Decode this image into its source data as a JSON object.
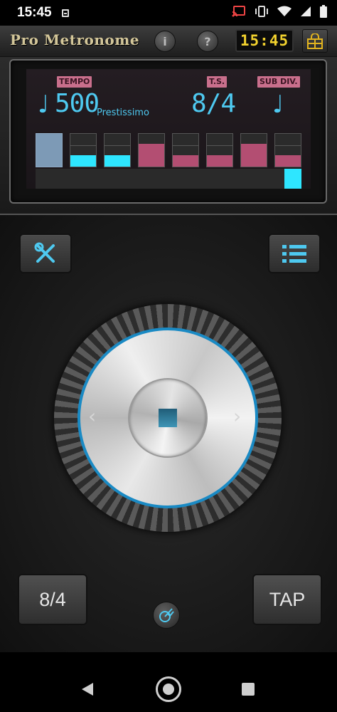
{
  "status_bar": {
    "time": "15:45"
  },
  "header": {
    "app_title": "Pro Metronome",
    "info_label": "i",
    "help_label": "?",
    "clock": "15:45"
  },
  "display": {
    "tempo_tag": "TEMPO",
    "ts_tag": "T.S.",
    "subdiv_tag": "SUB DIV.",
    "tempo_value": "500",
    "tempo_name": "Prestissimo",
    "time_signature": "8/4",
    "note_glyph": "♩",
    "subdiv_glyph": "♩",
    "beats": [
      {
        "kind": "accent",
        "level": 1.0
      },
      {
        "kind": "cyan",
        "level": 0.33
      },
      {
        "kind": "cyan",
        "level": 0.33
      },
      {
        "kind": "pink",
        "level": 0.66
      },
      {
        "kind": "pink",
        "level": 0.33
      },
      {
        "kind": "pink",
        "level": 0.33
      },
      {
        "kind": "pink",
        "level": 0.66
      },
      {
        "kind": "pink",
        "level": 0.33
      }
    ],
    "colors": {
      "cyan": "#2ee6ff",
      "pink": "#b34e72",
      "accent": "#7d9ab6",
      "digits": "#4ec9f0"
    }
  },
  "controls": {
    "tools_icon": "wrench-screwdriver-icon",
    "list_icon": "list-icon",
    "time_signature_button": "8/4",
    "tap_button": "TAP",
    "metronome_icon": "metronome-icon"
  },
  "dial": {
    "accent_color": "#1a8ac4",
    "prev_glyph": "‹",
    "next_glyph": "›"
  }
}
